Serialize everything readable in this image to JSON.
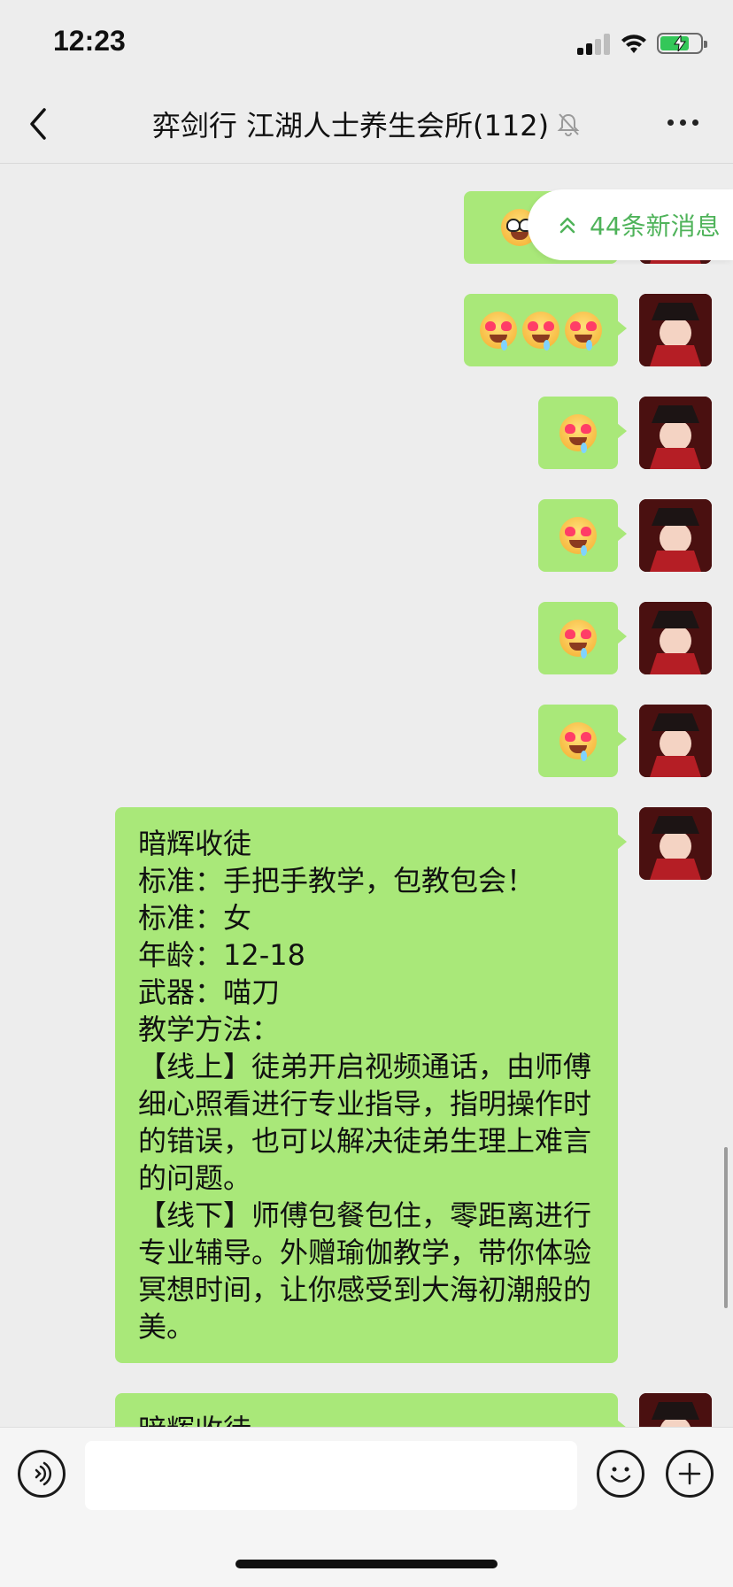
{
  "status_bar": {
    "time": "12:23"
  },
  "header": {
    "title": "弈剑行 江湖人士养生会所(112)"
  },
  "new_messages_pill": {
    "label": "44条新消息"
  },
  "messages": [
    {
      "type": "emoji",
      "count": 2
    },
    {
      "type": "emoji",
      "count": 3
    },
    {
      "type": "emoji",
      "count": 1
    },
    {
      "type": "emoji",
      "count": 1
    },
    {
      "type": "emoji",
      "count": 1
    },
    {
      "type": "emoji",
      "count": 1
    },
    {
      "type": "text",
      "text": "暗辉收徒\n标准：手把手教学，包教包会！\n标准：女\n年龄：12-18\n武器：喵刀\n教学方法：\n【线上】徒弟开启视频通话，由师傅细心照看进行专业指导，指明操作时的错误，也可以解决徒弟生理上难言的问题。\n【线下】师傅包餐包住，零距离进行专业辅导。外赠瑜伽教学，带你体验冥想时间，让你感受到大海初潮般的美。"
    },
    {
      "type": "text",
      "text": "暗辉收徒"
    }
  ],
  "input_bar": {
    "placeholder": ""
  },
  "colors": {
    "bubble": "#a9e879",
    "accent": "#4fb35a",
    "background": "#ededed"
  }
}
